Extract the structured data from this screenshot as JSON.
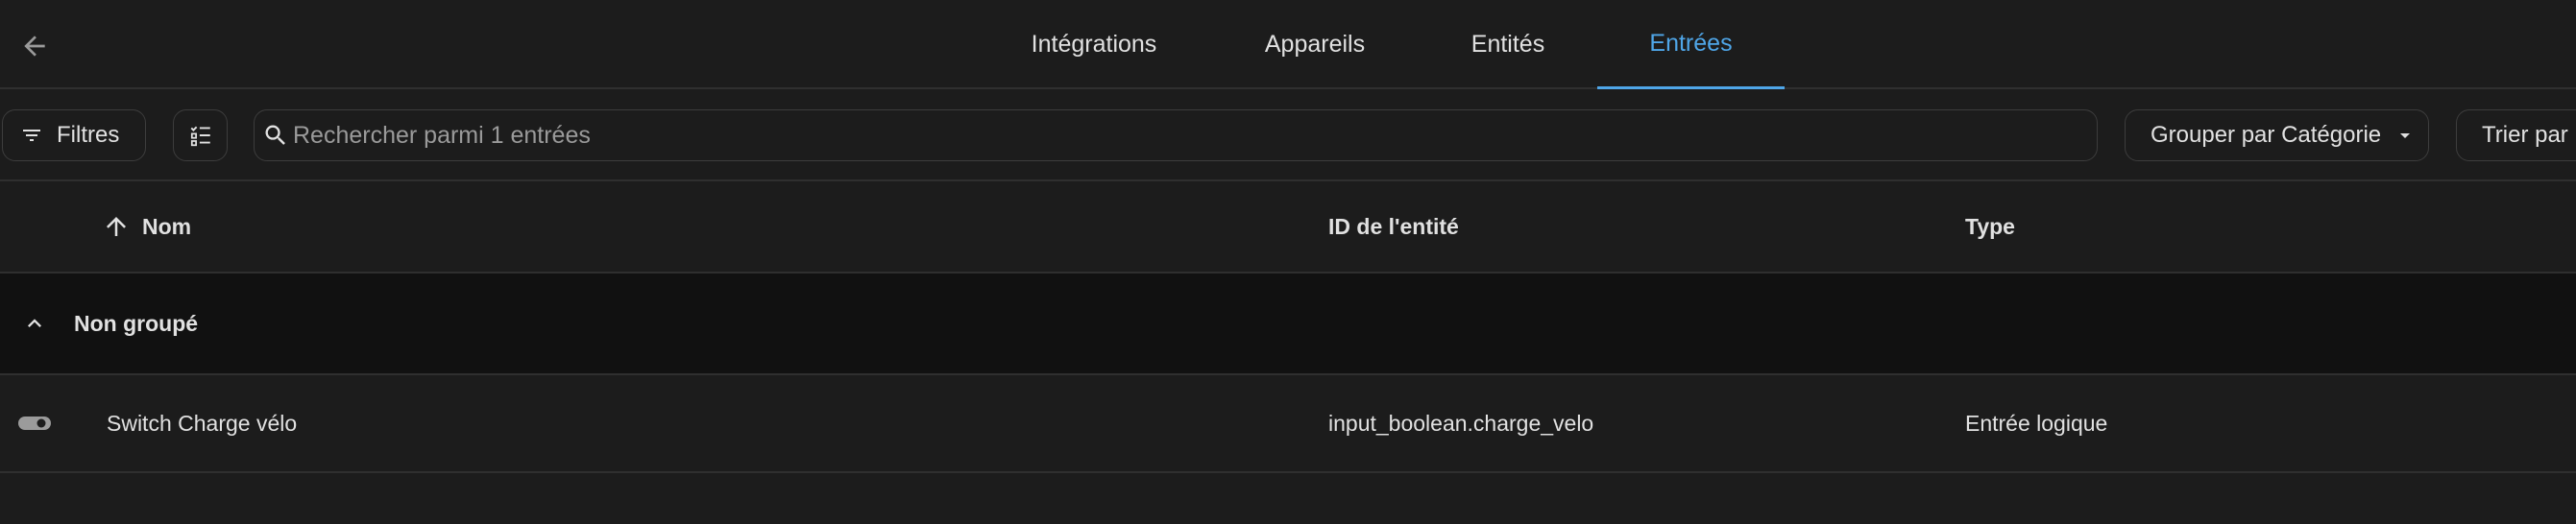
{
  "nav": {
    "back_icon": "arrow-left-icon",
    "tabs": [
      {
        "label": "Intégrations",
        "active": false
      },
      {
        "label": "Appareils",
        "active": false
      },
      {
        "label": "Entités",
        "active": false
      },
      {
        "label": "Entrées",
        "active": true
      }
    ]
  },
  "toolbar": {
    "filters_label": "Filtres",
    "filters_icon": "filter-icon",
    "select_mode_icon": "checklist-icon",
    "search_icon": "search-icon",
    "search_placeholder": "Rechercher parmi 1 entrées",
    "search_value": "",
    "group_by_label": "Grouper par Catégorie",
    "group_by_icon": "caret-down-icon",
    "sort_label": "Trier par N"
  },
  "table": {
    "sort_icon": "arrow-up-icon",
    "columns": [
      {
        "label": "Nom"
      },
      {
        "label": "ID de l'entité"
      },
      {
        "label": "Type"
      }
    ],
    "group": {
      "label": "Non groupé",
      "icon": "chevron-up-icon"
    },
    "rows": [
      {
        "icon": "toggle-switch-icon",
        "name": "Switch Charge vélo",
        "entity_id": "input_boolean.charge_velo",
        "type": "Entrée logique"
      }
    ]
  },
  "colors": {
    "background": "#1c1c1c",
    "accent": "#4fa6e8",
    "group_background": "#111111",
    "divider": "#2f2f2f",
    "text": "#e1e1e1"
  }
}
